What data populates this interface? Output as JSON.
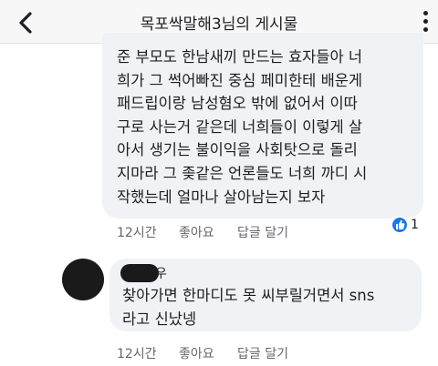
{
  "header": {
    "title": "목포싹말해3님의 게시물"
  },
  "comment1": {
    "lines": [
      "준 부모도 한남새끼 만드는 효자들아 너",
      "희가 그 썩어빠진 중심 페미한테 배운게",
      "패드립이랑 남성혐오 밖에 없어서 이따",
      "구로 사는거 같은데 너희들이 이렇게 살",
      "아서 생기는 불이익을 사회탓으로 돌리",
      "지마라 그 좆같은 언론들도 너희 까디 시",
      "작했는데 얼마나 살아남는지 보자"
    ],
    "time": "12시간",
    "like_label": "좋아요",
    "reply_label": "답글 달기",
    "reaction_icon": "thumbs-up-icon",
    "reaction_count": "1"
  },
  "comment2": {
    "author_suffix": "우",
    "lines": [
      "찾아가면 한마디도 못 씨부릴거면서 sns",
      "라고 신났넹"
    ],
    "time": "12시간",
    "like_label": "좋아요",
    "reply_label": "답글 달기"
  },
  "colors": {
    "like_blue": "#1877f2",
    "bubble_bg": "#f0f2f5",
    "meta_gray": "#65676b"
  }
}
